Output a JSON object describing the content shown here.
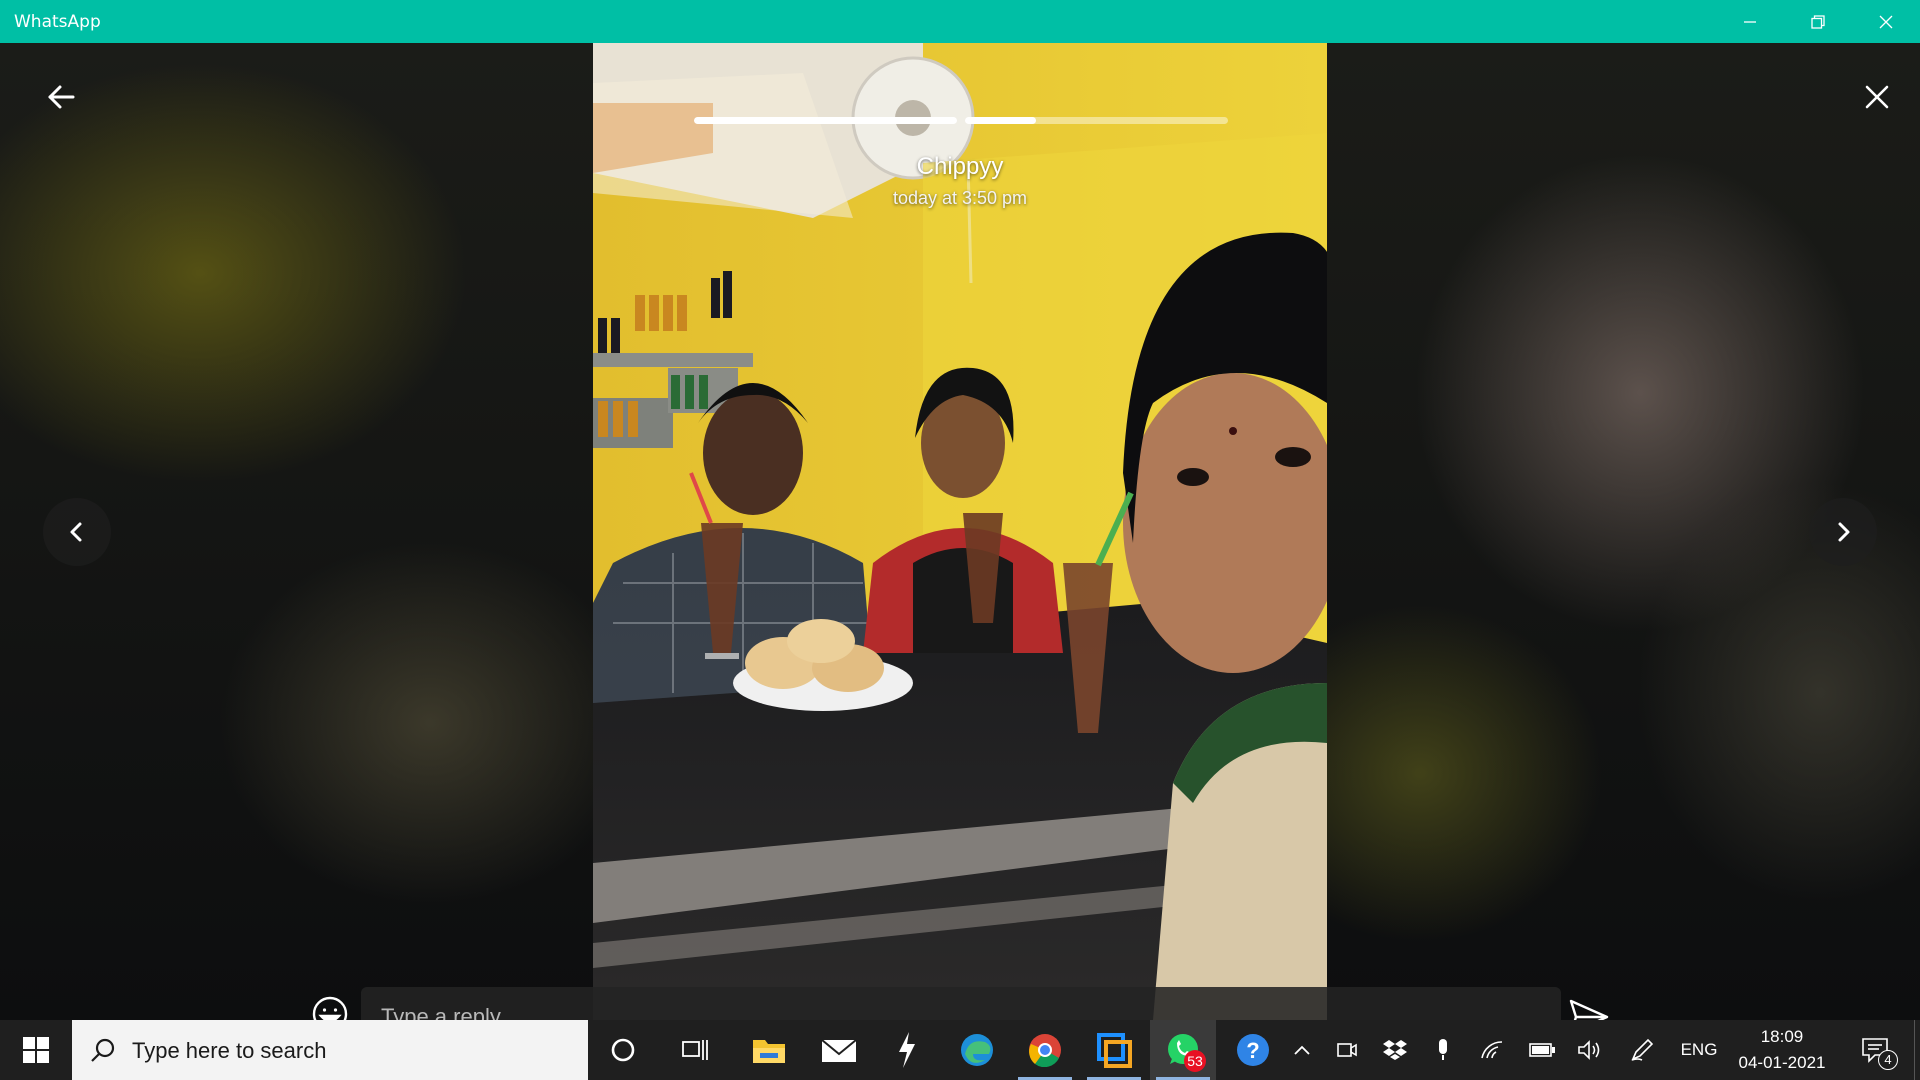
{
  "window": {
    "title": "WhatsApp",
    "accent_color": "#00bfa5"
  },
  "status_viewer": {
    "contact_name": "Chippyy",
    "posted_time": "today at 3:50 pm",
    "progress_segments": [
      {
        "fraction_complete": 1.0
      },
      {
        "fraction_complete": 0.27
      }
    ],
    "reply": {
      "placeholder": "Type a reply..."
    }
  },
  "taskbar": {
    "search_placeholder": "Type here to search",
    "pinned_apps": [
      "cortana-icon",
      "task-view-icon",
      "file-explorer-icon",
      "mail-icon",
      "app-icon",
      "edge-icon",
      "chrome-icon",
      "snip-icon",
      "whatsapp-icon",
      "help-icon"
    ],
    "whatsapp_badge": "53",
    "language": "ENG",
    "time": "18:09",
    "date": "04-01-2021",
    "notification_count": "4"
  }
}
